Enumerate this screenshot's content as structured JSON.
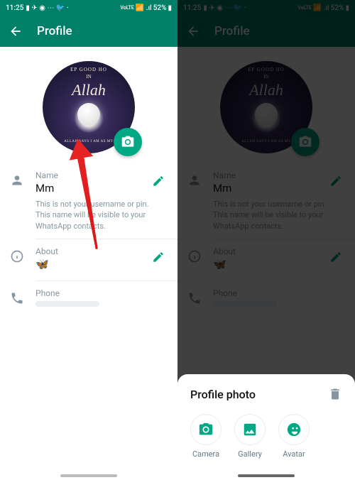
{
  "statusBar": {
    "time": "11:25",
    "battery": "52%",
    "signal": "VoLTE"
  },
  "header": {
    "title": "Profile"
  },
  "profilePic": {
    "topText": "EP GOOD HO",
    "inText": "IN",
    "mainText": "Allah",
    "subText": "ALLAH SAYS I AM AS MY"
  },
  "sections": {
    "nameLabel": "Name",
    "nameValue": "Mm",
    "nameHelper": "This is not your username or pin. This name will be visible to your WhatsApp contacts.",
    "aboutLabel": "About",
    "aboutValue": "🦋",
    "phoneLabel": "Phone"
  },
  "sheet": {
    "title": "Profile photo",
    "options": {
      "camera": "Camera",
      "gallery": "Gallery",
      "avatar": "Avatar"
    }
  }
}
